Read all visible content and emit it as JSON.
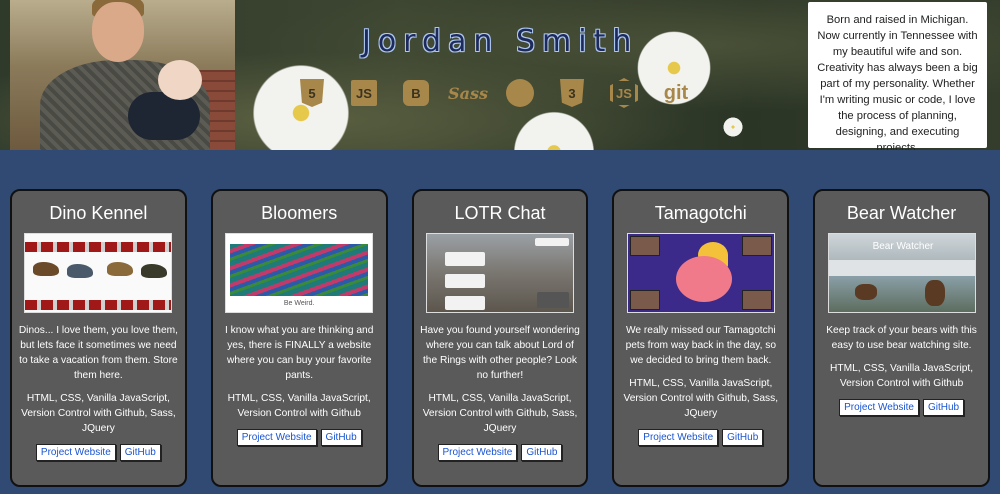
{
  "header": {
    "name": "Jordan Smith",
    "bio": "Born and raised in Michigan. Now currently in Tennessee with my beautiful wife and son. Creativity has always been a big part of my personality. Whether I'm writing music or code, I love the process of planning, designing, and executing projects.",
    "tech_icons": [
      {
        "icon": "html5-icon",
        "glyph": "5"
      },
      {
        "icon": "javascript-icon",
        "glyph": "JS"
      },
      {
        "icon": "bootstrap-icon",
        "glyph": "B"
      },
      {
        "icon": "sass-icon",
        "glyph": "Sass"
      },
      {
        "icon": "github-icon",
        "glyph": ""
      },
      {
        "icon": "css3-icon",
        "glyph": "3"
      },
      {
        "icon": "nodejs-icon",
        "glyph": "JS"
      },
      {
        "icon": "git-icon",
        "glyph": "git"
      }
    ],
    "accent_color": "#a8874a"
  },
  "projects": [
    {
      "title": "Dino Kennel",
      "description": "Dinos... I love them, you love them, but lets face it sometimes we need to take a vacation from them. Store them here.",
      "tech": "HTML, CSS, Vanilla JavaScript, Version Control with Github, Sass, JQuery",
      "website_label": "Project Website",
      "github_label": "GitHub"
    },
    {
      "title": "Bloomers",
      "description": "I know what you are thinking and yes, there is FINALLY a website where you can buy your favorite pants.",
      "tech": "HTML, CSS, Vanilla JavaScript, Version Control with Github",
      "website_label": "Project Website",
      "github_label": "GitHub",
      "thumb_caption": "Be Weird."
    },
    {
      "title": "LOTR Chat",
      "description": "Have you found yourself wondering where you can talk about Lord of the Rings with other people? Look no further!",
      "tech": "HTML, CSS, Vanilla JavaScript, Version Control with Github, Sass, JQuery",
      "website_label": "Project Website",
      "github_label": "GitHub"
    },
    {
      "title": "Tamagotchi",
      "description": "We really missed our Tamagotchi pets from way back in the day, so we decided to bring them back.",
      "tech": "HTML, CSS, Vanilla JavaScript, Version Control with Github, Sass, JQuery",
      "website_label": "Project Website",
      "github_label": "GitHub"
    },
    {
      "title": "Bear Watcher",
      "description": "Keep track of your bears with this easy to use bear watching site.",
      "tech": "HTML, CSS, Vanilla JavaScript, Version Control with Github",
      "website_label": "Project Website",
      "github_label": "GitHub",
      "thumb_caption": "Bear Watcher"
    }
  ]
}
